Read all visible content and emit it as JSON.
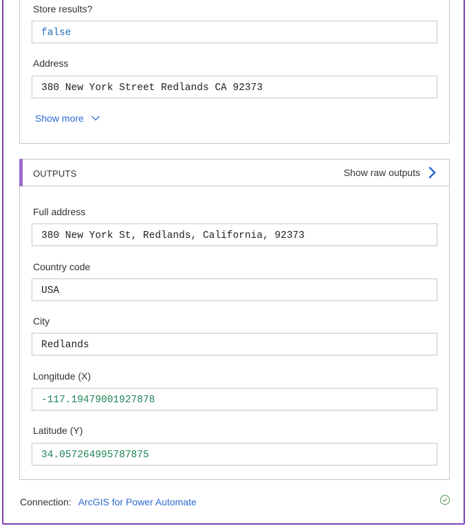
{
  "inputs": {
    "store_results": {
      "label": "Store results?",
      "value": "false"
    },
    "address": {
      "label": "Address",
      "value": "380 New York Street Redlands CA 92373"
    },
    "show_more": "Show more"
  },
  "outputs": {
    "header": "OUTPUTS",
    "show_raw": "Show raw outputs",
    "fields": {
      "full_address": {
        "label": "Full address",
        "value": "380 New York St, Redlands, California, 92373"
      },
      "country_code": {
        "label": "Country code",
        "value": "USA"
      },
      "city": {
        "label": "City",
        "value": "Redlands"
      },
      "longitude": {
        "label": "Longitude (X)",
        "value": "-117.19479001927878"
      },
      "latitude": {
        "label": "Latitude (Y)",
        "value": "34.057264995787875"
      }
    }
  },
  "footer": {
    "connection_label": "Connection:",
    "connection_name": "ArcGIS for Power Automate"
  },
  "colors": {
    "accent_purple": "#9c6bd1",
    "frame_purple": "#7b3fb5",
    "link_blue": "#2b6bd0",
    "number_green": "#1d8354",
    "success_green": "#5a9c5a"
  },
  "icons": {
    "show_more": "chevron-down-icon",
    "raw_outputs": "chevron-right-icon",
    "status": "check-circle-icon"
  }
}
